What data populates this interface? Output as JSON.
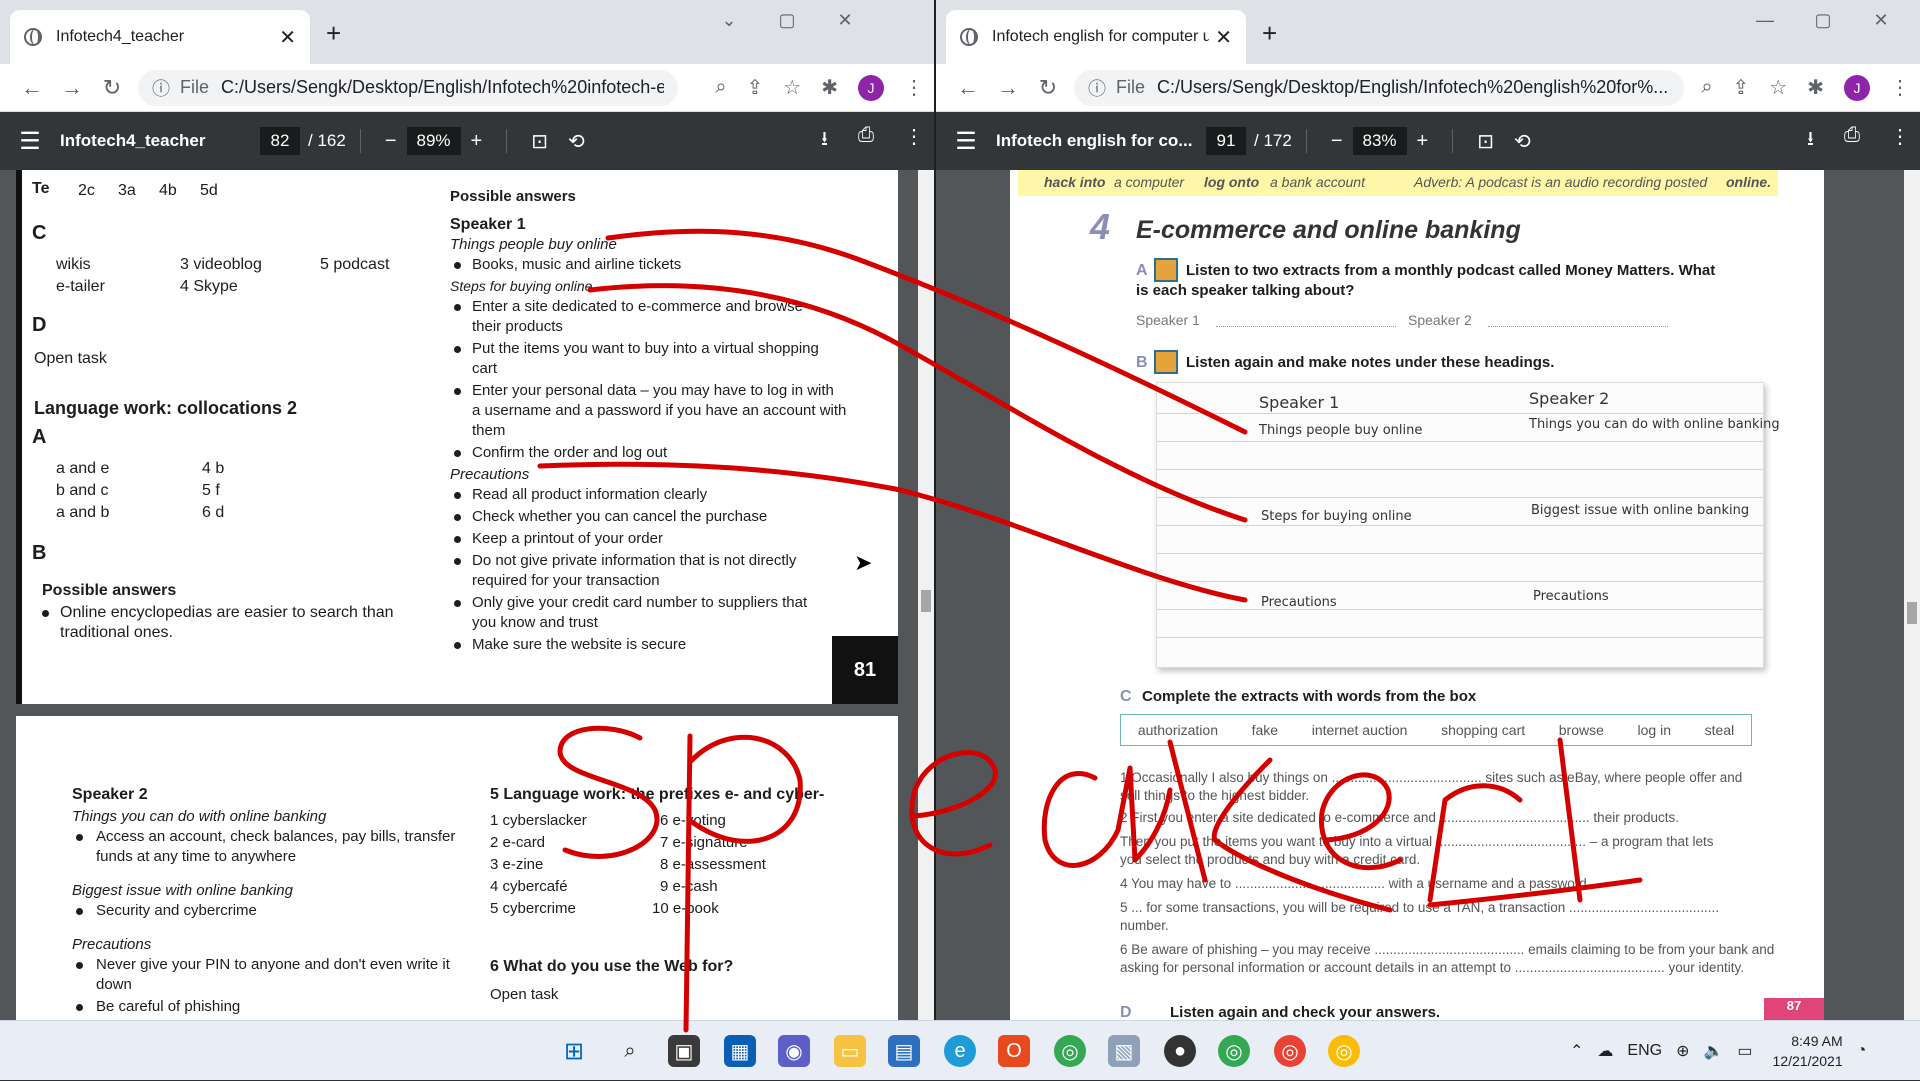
{
  "left": {
    "tab_title": "Infotech4_teacher",
    "url_scheme": "File",
    "url": "C:/Users/Sengk/Desktop/English/Infotech%20infotech-englis...",
    "doc_title": "Infotech4_teacher",
    "page_current": "82",
    "page_total": "/ 162",
    "zoom": "89%",
    "page1": {
      "top_row": [
        "Te",
        "2c",
        "3a",
        "4b",
        "5d"
      ],
      "c_label": "C",
      "list_c": [
        "wikis",
        "e-tailer",
        "3  videoblog",
        "4  Skype",
        "5  podcast"
      ],
      "d_label": "D",
      "open_task": "Open task",
      "lw_heading": "Language work: collocations 2",
      "a_label": "A",
      "lw_answers": [
        "a and e",
        "b and c",
        "a and b",
        "4  b",
        "5  f",
        "6  d"
      ],
      "b_label": "B",
      "possible_answers_left": "Possible answers",
      "enc_line1": "Online encyclopedias are easier to search than",
      "enc_line2": "traditional ones.",
      "possible_answers": "Possible answers",
      "speaker1": "Speaker 1",
      "things_people_buy": "Things people buy online",
      "books": "Books, music and airline tickets",
      "steps": "Steps for buying online",
      "step1a": "Enter a site dedicated to e-commerce and browse",
      "step1b": "their products",
      "step2a": "Put the items you want to buy into a virtual shopping",
      "step2b": "cart",
      "step3a": "Enter your personal data – you may have to log in with",
      "step3b": "a username and a password if you have an account with",
      "step3c": "them",
      "step4": "Confirm the order and log out",
      "precautions": "Precautions",
      "prec1": "Read all product information clearly",
      "prec2": "Check whether you can cancel the purchase",
      "prec3": "Keep a printout of your order",
      "prec4a": "Do not give private information that is not directly",
      "prec4b": "required for your transaction",
      "prec5a": "Only give your credit card number to suppliers that",
      "prec5b": "you know and trust",
      "prec6": "Make sure the website is secure",
      "page_number": "81"
    },
    "page2": {
      "speaker2": "Speaker 2",
      "things_can_do": "Things you can do with online banking",
      "access_a": "Access an account, check balances, pay bills, transfer",
      "access_b": "funds at any time to anywhere",
      "biggest_issue": "Biggest issue with online banking",
      "security": "Security and cybercrime",
      "precautions": "Precautions",
      "never_a": "Never give your PIN to anyone and don't even write it",
      "never_b": "down",
      "careful": "Be careful of phishing",
      "lw5_heading": "5  Language work: the prefixes e- and cyber-",
      "lw5_items": [
        "1  cyberslacker",
        "2  e-card",
        "3  e-zine",
        "4  cybercafé",
        "5  cybercrime",
        "6  e-voting",
        "7  e-signature",
        "8  e-assessment",
        "9  e-cash",
        "10  e-book"
      ],
      "q6_heading": "6  What do you use the Web for?",
      "open_task": "Open task"
    }
  },
  "right": {
    "tab_title": "Infotech english for computer us",
    "url_scheme": "File",
    "url": "C:/Users/Sengk/Desktop/English/Infotech%20english%20for%...",
    "doc_title": "Infotech english for co...",
    "page_current": "91",
    "page_total": "/ 172",
    "zoom": "83%",
    "page": {
      "strip_a": "hack into",
      "strip_a2": "a computer",
      "strip_b": "log onto",
      "strip_b2": "a bank account",
      "strip_c": "Adverb:  A podcast is an audio recording posted",
      "strip_c2": "online.",
      "unit_number": "4",
      "unit_title": "E-commerce and online banking",
      "task_a_label": "A",
      "task_a_line1": "Listen to two extracts from a monthly podcast called Money Matters. What",
      "task_a_line2": "is each speaker talking about?",
      "speaker1_blank": "Speaker 1",
      "speaker2_blank": "Speaker 2",
      "task_b_label": "B",
      "task_b": "Listen again and make notes under these headings.",
      "notes": {
        "sp1": "Speaker 1",
        "sp2": "Speaker 2",
        "row1_left": "Things people buy online",
        "row1_right": "Things you can do with online banking",
        "row2_left": "Steps for buying online",
        "row2_right": "Biggest issue with online banking",
        "row3_left": "Precautions",
        "row3_right": "Precautions"
      },
      "task_c_label": "C",
      "task_c": "Complete the extracts with words from the box",
      "word_box": [
        "authorization",
        "fake",
        "internet auction",
        "shopping cart",
        "browse",
        "log in",
        "steal"
      ],
      "items": [
        "1   Occasionally I also buy things on ........................................ sites such as eBay, where people offer and",
        "     sell things to the highest bidder.",
        "2   First you enter a site dedicated to e-commerce and ........................................ their products.",
        "     Then you put the items you want to buy into a virtual ........................................ – a program that lets",
        "     you select the products and buy with a credit card.",
        "4   You may have to ........................................ with a username and a password ...",
        "5   ... for some transactions, you will be required to use a TAN, a transaction ........................................",
        "     number.",
        "6   Be aware of phishing – you may receive ........................................ emails claiming to be from your bank and",
        "     asking for personal information or account details in an attempt to ........................................ your identity."
      ],
      "task_d_label": "D",
      "task_d": "Listen again and check your answers.",
      "corner_page": "87"
    }
  },
  "ink_text": "Speaker 1",
  "taskbar": {
    "lang": "ENG",
    "time": "8:49 AM",
    "date": "12/21/2021"
  },
  "colors": {
    "ink": "#d40000",
    "chrome_bar": "#dee1e6",
    "pdf_toolbar": "#323639",
    "viewer_bg": "#525659",
    "notes_line": "#c7d7ea",
    "wordbox_border": "#6fb7b0",
    "unit_number": "#8a8fb8"
  },
  "icons": [
    "globe-icon",
    "close-icon",
    "plus-icon",
    "back-icon",
    "forward-icon",
    "reload-icon",
    "info-icon",
    "zoom-icon",
    "share-icon",
    "star-icon",
    "extensions-icon",
    "menu-icon",
    "download-icon",
    "print-icon",
    "fit-icon",
    "rotate-icon",
    "windows-start-icon",
    "search-icon",
    "file-explorer-icon",
    "chrome-icon",
    "edge-icon",
    "office-icon",
    "wifi-icon",
    "volume-icon",
    "battery-icon",
    "mouse-cursor-icon"
  ]
}
